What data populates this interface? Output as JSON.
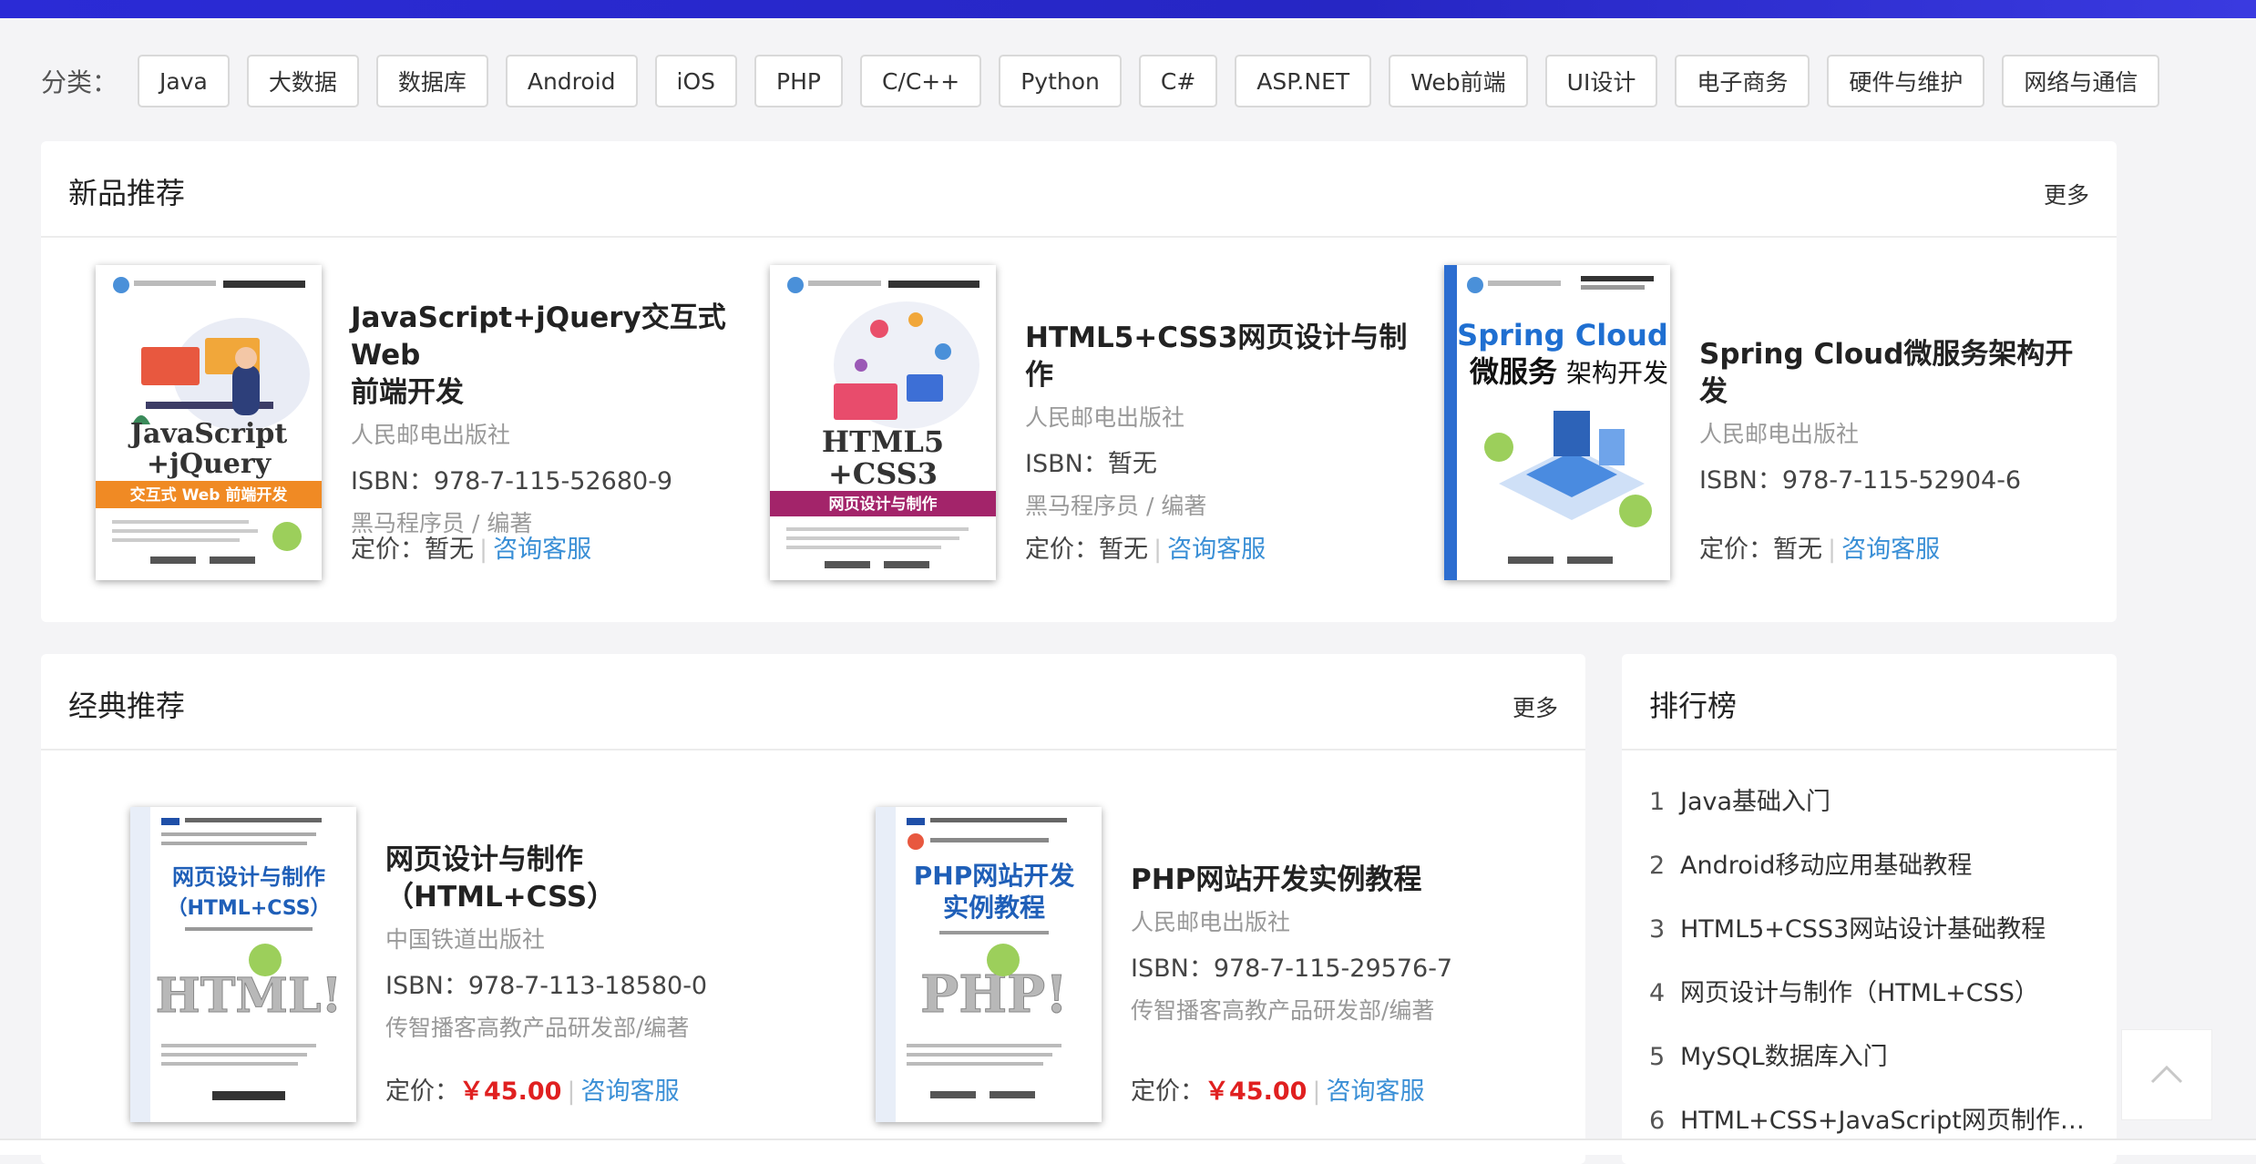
{
  "categories": {
    "label": "分类：",
    "items": [
      "Java",
      "大数据",
      "数据库",
      "Android",
      "iOS",
      "PHP",
      "C/C++",
      "Python",
      "C#",
      "ASP.NET",
      "Web前端",
      "UI设计",
      "电子商务",
      "硬件与维护",
      "网络与通信"
    ]
  },
  "new_books": {
    "title": "新品推荐",
    "more": "更多",
    "books": [
      {
        "title_line1": "JavaScript+jQuery交互式Web",
        "title_line2": "前端开发",
        "publisher": "人民邮电出版社",
        "isbn": "ISBN：978-7-115-52680-9",
        "author": "黑马程序员 / 编著",
        "price_label": "定价：",
        "price": "暂无",
        "consult": "咨询客服",
        "cover_line1": "JavaScript",
        "cover_line2": "+jQuery",
        "cover_band": "交互式 Web 前端开发"
      },
      {
        "title_line1": "HTML5+CSS3网页设计与制作",
        "publisher": "人民邮电出版社",
        "isbn": "ISBN：暂无",
        "author": "黑马程序员 / 编著",
        "price_label": "定价：",
        "price": "暂无",
        "consult": "咨询客服",
        "cover_line1": "HTML5",
        "cover_line2": "+CSS3",
        "cover_band": "网页设计与制作"
      },
      {
        "title_line1": "Spring Cloud微服务架构开发",
        "publisher": "人民邮电出版社",
        "isbn": "ISBN：978-7-115-52904-6",
        "price_label": "定价：",
        "price": "暂无",
        "consult": "咨询客服",
        "cover_line1": "Spring Cloud",
        "cover_line2a": "微服务",
        "cover_line2b": "架构开发"
      }
    ]
  },
  "classic_books": {
    "title": "经典推荐",
    "more": "更多",
    "books": [
      {
        "title_line1": "网页设计与制作",
        "title_line2": "（HTML+CSS）",
        "publisher": "中国铁道出版社",
        "isbn": "ISBN：978-7-113-18580-0",
        "author": "传智播客高教产品研发部/编著",
        "price_label": "定价：",
        "price": "￥45.00",
        "consult": "咨询客服",
        "cover_line1": "网页设计与制作",
        "cover_line2": "（HTML+CSS）",
        "cover_art": "HTML!"
      },
      {
        "title_line1": "PHP网站开发实例教程",
        "publisher": "人民邮电出版社",
        "isbn": "ISBN：978-7-115-29576-7",
        "author": "传智播客高教产品研发部/编著",
        "price_label": "定价：",
        "price": "￥45.00",
        "consult": "咨询客服",
        "cover_line1": "PHP网站开发",
        "cover_line2": "实例教程",
        "cover_art": "PHP!"
      }
    ]
  },
  "ranking": {
    "title": "排行榜",
    "items": [
      {
        "num": "1",
        "label": "Java基础入门"
      },
      {
        "num": "2",
        "label": "Android移动应用基础教程"
      },
      {
        "num": "3",
        "label": "HTML5+CSS3网站设计基础教程"
      },
      {
        "num": "4",
        "label": "网页设计与制作（HTML+CSS）"
      },
      {
        "num": "5",
        "label": "MySQL数据库入门"
      },
      {
        "num": "6",
        "label": "HTML+CSS+JavaScript网页制作…"
      }
    ]
  },
  "colors": {
    "accent_link": "#3a8fd6",
    "price_red": "#e02020",
    "top_bar": "#2b2bd6"
  },
  "icons": {
    "back_to_top": "chevron-up-icon"
  }
}
